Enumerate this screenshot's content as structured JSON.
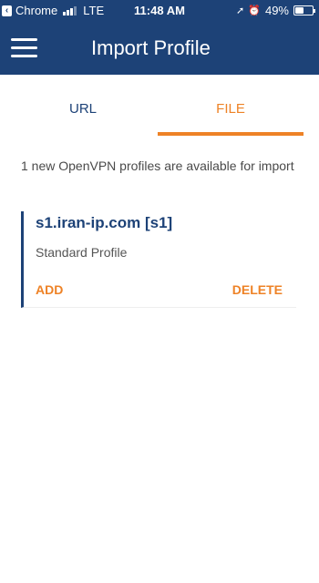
{
  "status_bar": {
    "carrier": "Chrome",
    "network": "LTE",
    "time": "11:48 AM",
    "battery": "49%",
    "battery_level": 0.49
  },
  "app_bar": {
    "title": "Import Profile"
  },
  "tabs": [
    {
      "label": "URL",
      "selected": false
    },
    {
      "label": "FILE",
      "selected": true
    }
  ],
  "main": {
    "info": "1 new OpenVPN profiles are available for import",
    "profiles": [
      {
        "name": "s1.iran-ip.com [s1]",
        "type": "Standard Profile",
        "add_label": "ADD",
        "delete_label": "DELETE"
      }
    ]
  },
  "colors": {
    "primary": "#1d4277",
    "accent": "#ee8226"
  },
  "icons": [
    "back-to-app-icon",
    "signal-icon",
    "location-arrow-icon",
    "alarm-icon",
    "battery-icon",
    "hamburger-menu-icon"
  ]
}
